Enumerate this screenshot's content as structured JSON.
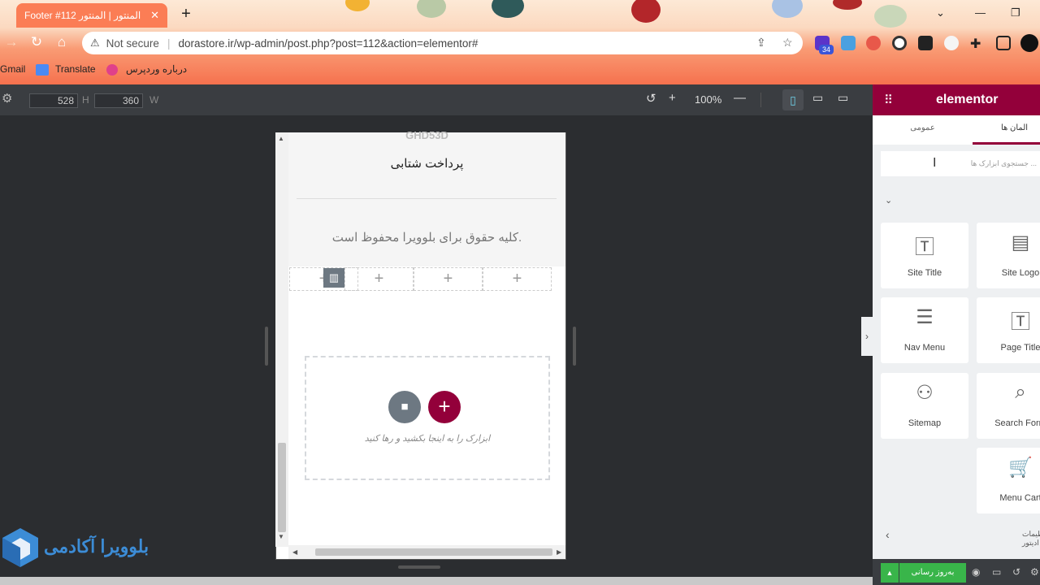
{
  "browser": {
    "tab_title": "Footer #112 المنتور | المنتور",
    "close": "✕",
    "new_tab": "+",
    "security": "Not secure",
    "url": "dorastore.ir/wp-admin/post.php?post=112&action=elementor#",
    "extension_badge": "34",
    "bookmarks": [
      "Gmail",
      "Translate",
      "درباره وردپرس"
    ]
  },
  "toolbar": {
    "width_value": "528",
    "height_label": "H",
    "height_value": "360",
    "width_label": "W",
    "zoom": "100%"
  },
  "canvas": {
    "ghd": "GHD53D",
    "fast_payment": "پرداخت شتابی",
    "copyright": "کلیه حقوق برای بلوویرا محفوظ است.",
    "drop_text": "ابزارک را به اینجا بکشید و رها کنید"
  },
  "logo": {
    "text": "بلوویرا آکادمی"
  },
  "sidebar": {
    "brand": "elementor",
    "tab_elements": "المان ها",
    "tab_general": "عمومی",
    "search_placeholder": "جستجوی ابزارک ها ...",
    "widgets": [
      "Site Title",
      "Site Logo",
      "Nav Menu",
      "Page Title",
      "Sitemap",
      "Search Form",
      "Menu Cart"
    ],
    "footer_text": "تنظیمات ادیتور",
    "publish": "به‌روز رسانی"
  },
  "colors": {
    "accent": "#93003a",
    "publish": "#39b54a"
  }
}
